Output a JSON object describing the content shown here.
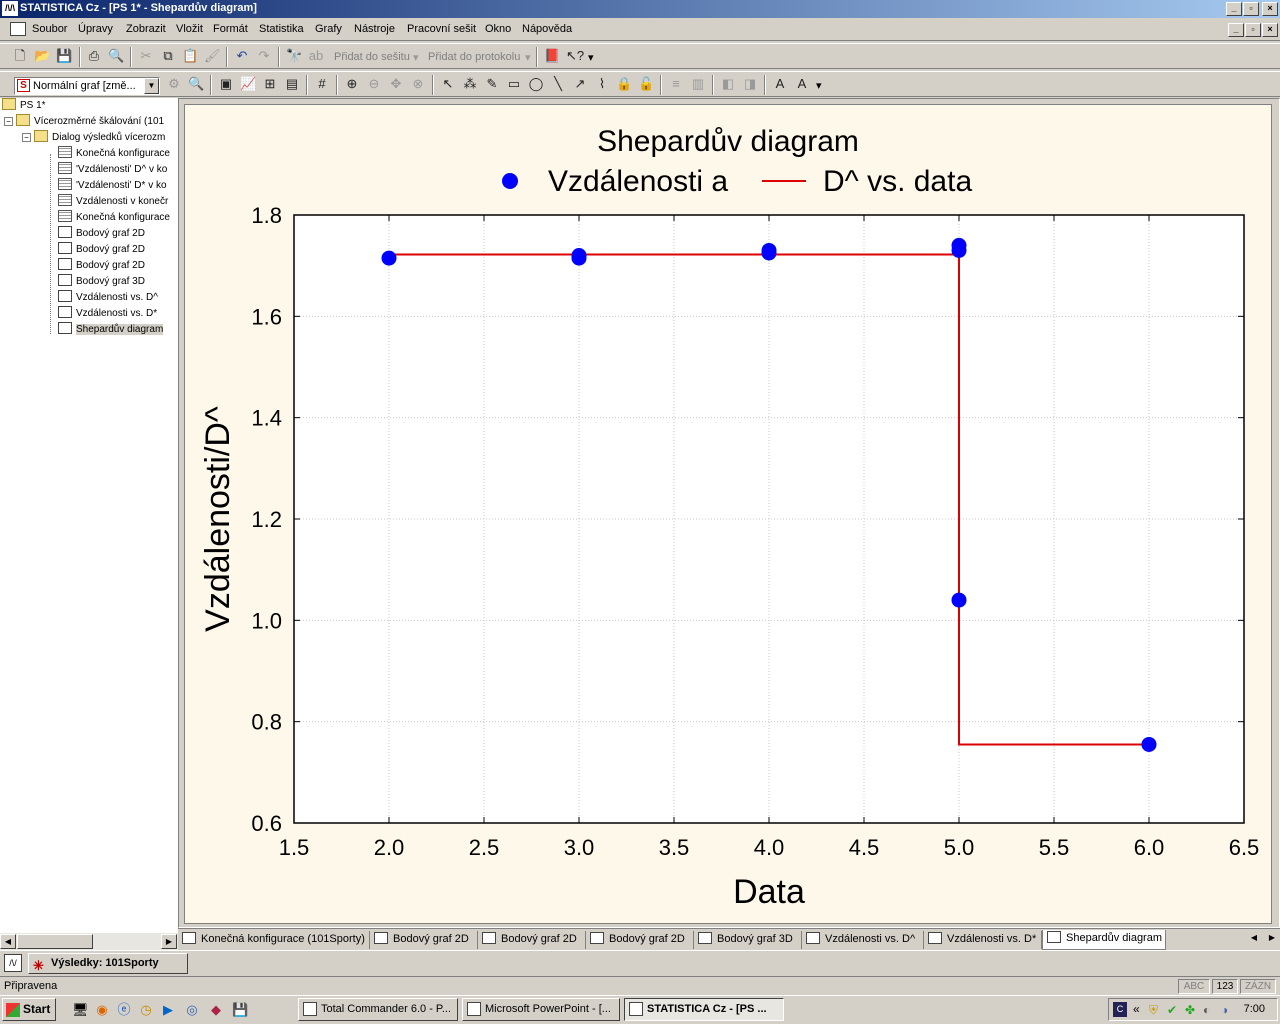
{
  "window": {
    "title": "STATISTICA Cz - [PS 1* - Shepardův diagram]",
    "app_icon": "statistica-icon",
    "buttons": {
      "minimize": "_",
      "maximize": "▫",
      "close": "×"
    }
  },
  "menu": {
    "items": [
      "Soubor",
      "Úpravy",
      "Zobrazit",
      "Vložit",
      "Formát",
      "Statistika",
      "Grafy",
      "Nástroje",
      "Pracovní sešit",
      "Okno",
      "Nápověda"
    ]
  },
  "toolbar1": {
    "add_to_workbook": "Přidat do sešitu",
    "add_to_report": "Přidat do protokolu"
  },
  "toolbar2": {
    "graph_type_combo": "Normální graf [změ..."
  },
  "tree": {
    "root": "PS 1*",
    "group": "Vícerozměrné škálování (101",
    "dialog": "Dialog výsledků vícerozm",
    "items": [
      {
        "label": "Konečná konfigurace",
        "kind": "sheet"
      },
      {
        "label": "'Vzdálenosti' D^ v ko",
        "kind": "sheet"
      },
      {
        "label": "'Vzdálenosti' D* v ko",
        "kind": "sheet"
      },
      {
        "label": "Vzdálenosti v konečr",
        "kind": "sheet"
      },
      {
        "label": "Konečná konfigurace",
        "kind": "sheet"
      },
      {
        "label": "Bodový graf 2D",
        "kind": "graph"
      },
      {
        "label": "Bodový graf 2D",
        "kind": "graph"
      },
      {
        "label": "Bodový graf 2D",
        "kind": "graph"
      },
      {
        "label": "Bodový graf 3D",
        "kind": "graph"
      },
      {
        "label": "Vzdálenosti vs. D^",
        "kind": "graph"
      },
      {
        "label": "Vzdálenosti vs. D*",
        "kind": "graph"
      },
      {
        "label": "Shepardův diagram",
        "kind": "graph",
        "selected": true
      }
    ]
  },
  "chart_data": {
    "type": "scatter",
    "title": "Shepardův diagram",
    "xlabel": "Data",
    "ylabel": "Vzdálenosti/D^",
    "xlim": [
      1.5,
      6.5
    ],
    "ylim": [
      0.6,
      1.8
    ],
    "x_ticks": [
      "1.5",
      "2.0",
      "2.5",
      "3.0",
      "3.5",
      "4.0",
      "4.5",
      "5.0",
      "5.5",
      "6.0",
      "6.5"
    ],
    "y_ticks": [
      "0.6",
      "0.8",
      "1.0",
      "1.2",
      "1.4",
      "1.6",
      "1.8"
    ],
    "grid": true,
    "legend_position": "top",
    "legend": [
      "Vzdálenosti a",
      "D^ vs. data"
    ],
    "colors": {
      "points": "#0000ff",
      "line": "#dd0000",
      "background": "#fdf8ea"
    },
    "series": [
      {
        "name": "Vzdálenosti a",
        "kind": "points",
        "x": [
          2.0,
          3.0,
          3.0,
          4.0,
          4.0,
          5.0,
          5.0,
          5.0,
          6.0
        ],
        "y": [
          1.715,
          1.72,
          1.715,
          1.73,
          1.725,
          1.74,
          1.73,
          1.04,
          0.755
        ]
      },
      {
        "name": "D^ vs. data",
        "kind": "step-line",
        "x": [
          2.0,
          5.0,
          5.0,
          6.0
        ],
        "y": [
          1.722,
          1.722,
          0.755,
          0.755
        ]
      }
    ]
  },
  "tabs": [
    {
      "label": "Konečná konfigurace (101Sporty)",
      "kind": "sheet"
    },
    {
      "label": "Bodový graf 2D",
      "kind": "graph"
    },
    {
      "label": "Bodový graf 2D",
      "kind": "graph"
    },
    {
      "label": "Bodový graf 2D",
      "kind": "graph"
    },
    {
      "label": "Bodový graf 3D",
      "kind": "graph"
    },
    {
      "label": "Vzdálenosti vs. D^",
      "kind": "graph"
    },
    {
      "label": "Vzdálenosti vs. D*",
      "kind": "graph"
    },
    {
      "label": "Shepardův diagram",
      "kind": "graph",
      "active": true
    }
  ],
  "results_bar": {
    "label": "Výsledky: 101Sporty"
  },
  "status": {
    "text": "Připravena",
    "abc": "ABC",
    "num": "123",
    "rec": "ZÁZN"
  },
  "taskbar": {
    "start": "Start",
    "tasks": [
      {
        "label": "Total Commander 6.0 - P..."
      },
      {
        "label": "Microsoft PowerPoint - [..."
      },
      {
        "label": "STATISTICA Cz - [PS ...",
        "active": true
      }
    ],
    "tray_chevron": "«",
    "clock": "7:00"
  }
}
